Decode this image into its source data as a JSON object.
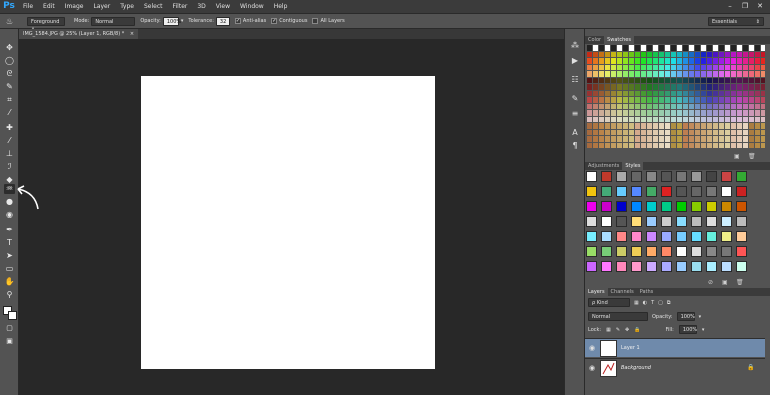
{
  "app": {
    "logo": "Ps"
  },
  "menu": [
    "File",
    "Edit",
    "Image",
    "Layer",
    "Type",
    "Select",
    "Filter",
    "3D",
    "View",
    "Window",
    "Help"
  ],
  "window_controls": {
    "minimize": "–",
    "restore": "❐",
    "close": "✕"
  },
  "options_bar": {
    "fill_source": "Foreground",
    "mode_label": "Mode:",
    "mode_value": "Normal",
    "opacity_label": "Opacity:",
    "opacity_value": "100%",
    "tolerance_label": "Tolerance:",
    "tolerance_value": "32",
    "antialias_label": "Anti-alias",
    "contiguous_label": "Contiguous",
    "all_layers_label": "All Layers",
    "workspace": "Essentials"
  },
  "document": {
    "tab_title": "IMG_1584.JPG @ 25% (Layer 1, RGB/8) *",
    "close": "×"
  },
  "panels": {
    "color_tabs": [
      "Color",
      "Swatches"
    ],
    "color_active": 1,
    "adjust_tabs": [
      "Adjustments",
      "Styles"
    ],
    "adjust_active": 1,
    "layers_tabs": [
      "Layers",
      "Channels",
      "Paths"
    ],
    "layers_active": 0
  },
  "layers": {
    "filter_kind": "ρ Kind",
    "blend_mode": "Normal",
    "opacity_label": "Opacity:",
    "opacity_value": "100%",
    "lock_label": "Lock:",
    "fill_label": "Fill:",
    "fill_value": "100%",
    "items": [
      {
        "name": "Layer 1",
        "selected": true
      },
      {
        "name": "Background",
        "selected": false,
        "locked": true
      }
    ]
  },
  "tools": [
    "move-icon",
    "marquee-icon",
    "lasso-icon",
    "quick-select-icon",
    "crop-icon",
    "eyedropper-icon",
    "healing-brush-icon",
    "brush-icon",
    "clone-stamp-icon",
    "history-brush-icon",
    "eraser-icon",
    "paint-bucket-icon",
    "blur-icon",
    "dodge-icon",
    "pen-icon",
    "type-icon",
    "path-select-icon",
    "rectangle-icon",
    "hand-icon",
    "zoom-icon"
  ],
  "colors": {
    "accent": "#31a8ff",
    "canvas": "#ffffff",
    "selected_layer": "#6f8aab"
  }
}
